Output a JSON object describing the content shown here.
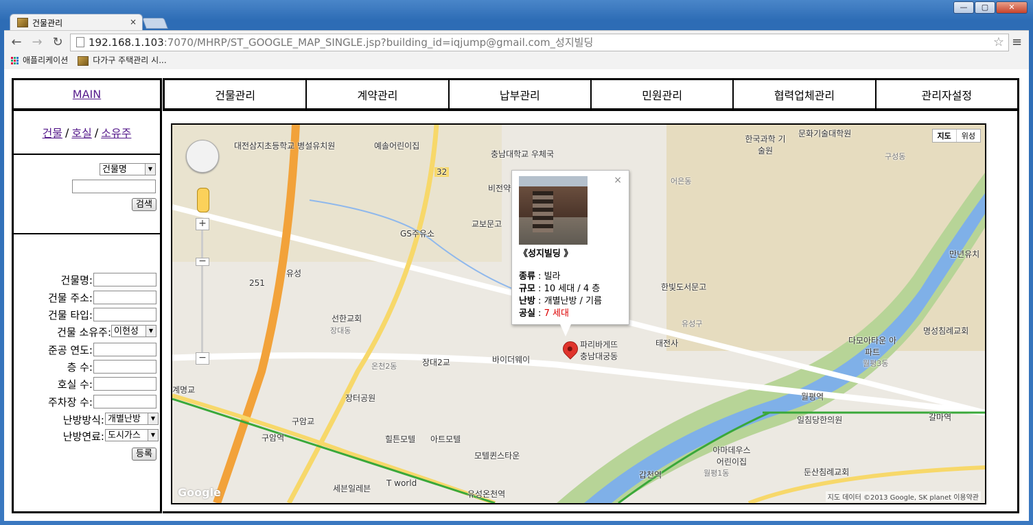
{
  "browser": {
    "tab_title": "건물관리",
    "tab_close": "×",
    "url_host": "192.168.1.103",
    "url_rest": ":7070/MHRP/ST_GOOGLE_MAP_SINGLE.jsp?building_id=iqjump@gmail.com_성지빌딩",
    "bookmarks": [
      "애플리케이션",
      "다가구 주택관리 시..."
    ],
    "back_icon": "←",
    "forward_icon": "→",
    "reload_icon": "↻",
    "star_icon": "☆",
    "menu_icon": "≡",
    "win_min": "—",
    "win_max": "▢",
    "win_close": "✕"
  },
  "topnav": {
    "main": "MAIN",
    "items": [
      "건물관리",
      "계약관리",
      "납부관리",
      "민원관리",
      "협력업체관리",
      "관리자설정"
    ]
  },
  "sidebar": {
    "links": [
      "건물",
      "호실",
      "소유주"
    ],
    "separator": "/",
    "search": {
      "select_value": "건물명",
      "button": "검색"
    },
    "form": {
      "fields": [
        {
          "label": "건물명:"
        },
        {
          "label": "건물 주소:"
        },
        {
          "label": "건물 타입:"
        },
        {
          "label": "건물 소유주:",
          "select": "이현성"
        },
        {
          "label": "준공 연도:"
        },
        {
          "label": "층 수:"
        },
        {
          "label": "호실 수:"
        },
        {
          "label": "주차장 수:"
        },
        {
          "label": "난방방식:",
          "select": "개별난방"
        },
        {
          "label": "난방연료:",
          "select": "도시가스"
        }
      ],
      "submit": "등록"
    }
  },
  "map": {
    "map_type": [
      "지도",
      "위성"
    ],
    "zoom_in": "+",
    "zoom_out": "−",
    "labels": [
      "대전삼지초등학교 병설유치원",
      "예솔어린이집",
      "충남대학교 우체국",
      "비전약국",
      "교보문고",
      "GS주유소",
      "유성",
      "251",
      "선한교회",
      "장대동",
      "장대2교",
      "바이더웨이",
      "파리바게뜨 충남대궁동",
      "한빛도서문고",
      "유성구",
      "태전사",
      "한국과학 기술원",
      "문화기술대학원",
      "어은동",
      "구성동",
      "만년유치",
      "다모아타운 아파트",
      "명성침례교회",
      "월평3동",
      "월평역",
      "일침당한의원",
      "갈마역",
      "아마데우스 어린이집",
      "월평1동",
      "갑천역",
      "둔산침례교회",
      "계명교",
      "장터공원",
      "구암교",
      "구암역",
      "힐튼모텔",
      "아트모텔",
      "모텔퀸스타운",
      "세븐일레븐",
      "T world",
      "유성온천역",
      "32",
      "온천2동"
    ],
    "info": {
      "title": "《성지빌딩 》",
      "type_label": "종류",
      "type_value": "빌라",
      "scale_label": "규모",
      "scale_value": "10 세대 / 4 층",
      "heat_label": "난방",
      "heat_value": "개별난방 / 기름",
      "vacancy_label": "공실",
      "vacancy_value": "7 세대",
      "close": "×"
    },
    "google": "Google",
    "copyright": "지도 데이터 ©2013 Google, SK planet    이용약관"
  }
}
